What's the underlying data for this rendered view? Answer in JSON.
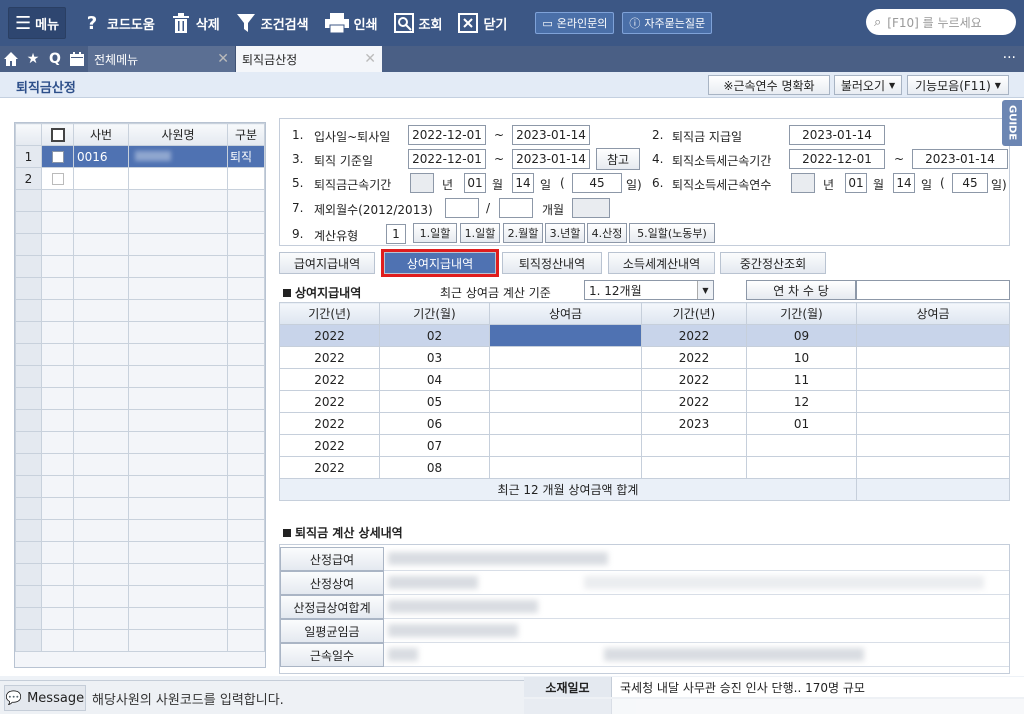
{
  "toolbar": {
    "menu": "메뉴",
    "code_help": "코드도움",
    "delete": "삭제",
    "condition_search": "조건검색",
    "print": "인쇄",
    "lookup": "조회",
    "close": "닫기",
    "online_inquiry": "온라인문의",
    "faq": "자주묻는질문",
    "search_placeholder": "[F10] 를 누르세요"
  },
  "tabs": {
    "all_menu": "전체메뉴",
    "active": "퇴직금산정"
  },
  "header": {
    "title": "퇴직금산정",
    "btn_clarify": "※근속연수 명확화",
    "btn_load": "불러오기",
    "btn_functions": "기능모음(F11)",
    "guide": "GUIDE"
  },
  "employees": {
    "columns": [
      "사번",
      "사원명",
      "구분"
    ],
    "rows": [
      {
        "no": "1",
        "id": "0016",
        "type": "퇴직"
      },
      {
        "no": "2",
        "id": "",
        "type": ""
      }
    ]
  },
  "form": {
    "l1": "1.",
    "l1_label": "입사일~퇴사일",
    "hire_date": "2022-12-01",
    "tilde": "~",
    "leave_date": "2023-01-14",
    "l2": "2.",
    "l2_label": "퇴직금 지급일",
    "pay_date": "2023-01-14",
    "l3": "3.",
    "l3_label": "퇴직 기준일",
    "base_from": "2022-12-01",
    "base_to": "2023-01-14",
    "ref_btn": "참고",
    "l4": "4.",
    "l4_label": "퇴직소득세근속기간",
    "tax_from": "2022-12-01",
    "tax_to": "2023-01-14",
    "l5": "5.",
    "l5_label": "퇴직금근속기간",
    "svc_years": "",
    "svc_months": "01",
    "svc_days": "14",
    "svc_total": "45",
    "u_year": "년",
    "u_month": "월",
    "u_day": "일",
    "paren_open": "(",
    "u_day_close": "일)",
    "l6": "6.",
    "l6_label": "퇴직소득세근속연수",
    "tax_years": "",
    "tax_months": "01",
    "tax_days": "14",
    "tax_total": "45",
    "l7": "7.",
    "l7_label": "제외월수(2012/2013)",
    "slash": "/",
    "excl_unit": "개월",
    "l9": "9.",
    "l9_label": "계산유형",
    "calc_type": "1",
    "calc_opts": [
      "1.일할",
      "1.일할",
      "2.월할",
      "3.년할",
      "4.산정",
      "5.일할(노동부)"
    ]
  },
  "subtabs": [
    "급여지급내역",
    "상여지급내역",
    "퇴직정산내역",
    "소득세계산내역",
    "중간정산조회"
  ],
  "bonus": {
    "section_title": "상여지급내역",
    "recent_label": "최근 상여금 계산 기준",
    "recent_value": "1. 12개월",
    "annual_allowance": "연 차 수 당",
    "headers": [
      "기간(년)",
      "기간(월)",
      "상여금",
      "기간(년)",
      "기간(월)",
      "상여금"
    ],
    "left": [
      {
        "y": "2022",
        "m": "02"
      },
      {
        "y": "2022",
        "m": "03"
      },
      {
        "y": "2022",
        "m": "04"
      },
      {
        "y": "2022",
        "m": "05"
      },
      {
        "y": "2022",
        "m": "06"
      },
      {
        "y": "2022",
        "m": "07"
      },
      {
        "y": "2022",
        "m": "08"
      }
    ],
    "right": [
      {
        "y": "2022",
        "m": "09"
      },
      {
        "y": "2022",
        "m": "10"
      },
      {
        "y": "2022",
        "m": "11"
      },
      {
        "y": "2022",
        "m": "12"
      },
      {
        "y": "2023",
        "m": "01"
      },
      {
        "y": "",
        "m": ""
      },
      {
        "y": "",
        "m": ""
      }
    ],
    "total_label": "최근 12 개월 상여금액 합계"
  },
  "detail": {
    "section_title": "퇴직금 계산 상세내역",
    "rows": [
      "산정급여",
      "산정상여",
      "산정급상여합계",
      "일평균임금",
      "근속일수"
    ]
  },
  "footer": {
    "message_btn": "Message",
    "message_text": "해당사원의 사원코드를 입력합니다.",
    "row1_label": "소재일모",
    "row1_value": "국세청 내달 사무관 승진 인사 단행.. 170명 규모"
  }
}
